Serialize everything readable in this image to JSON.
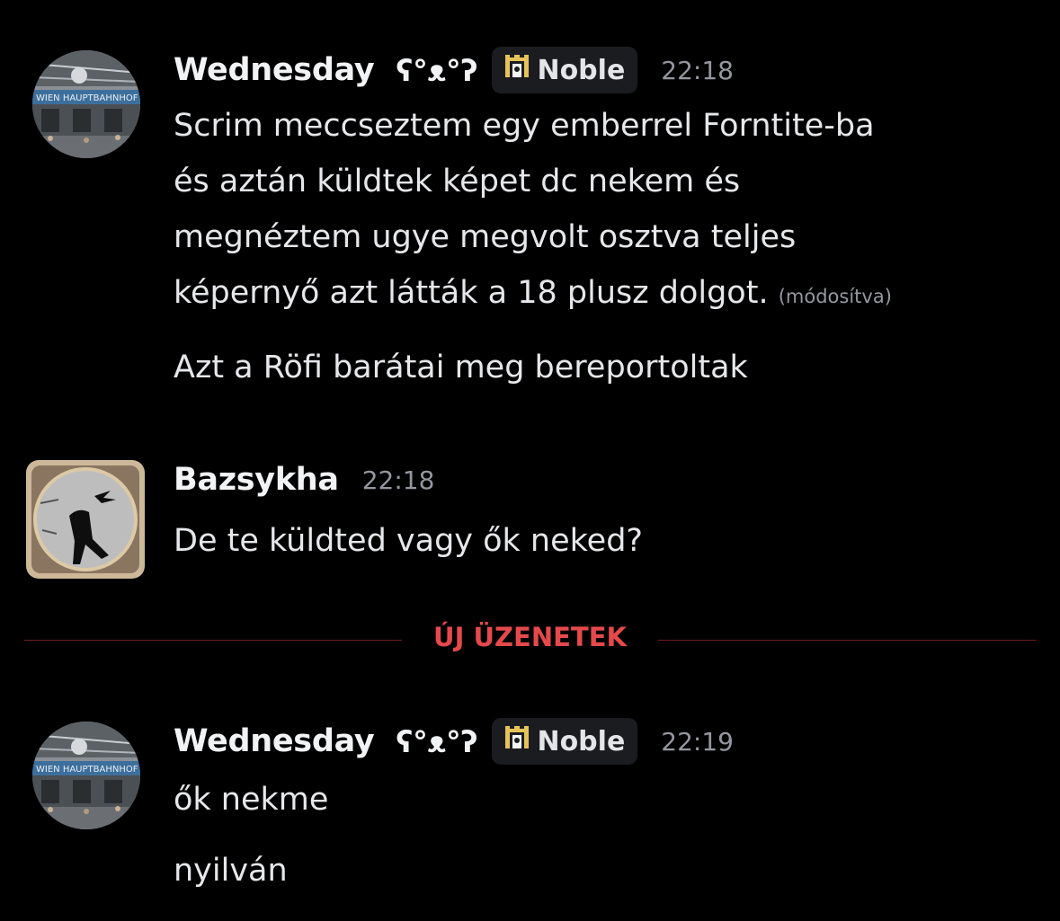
{
  "messages": [
    {
      "author": "Wednesday",
      "author_extra": "ʕ°ᴥ°ʔ",
      "tag": "Noble",
      "time": "22:18",
      "lines": [
        "Scrim meccseztem egy emberrel Forntite-ba\nés aztán küldtek képet dc nekem és\nmegnéztem ugye megvolt osztva teljes\nképernyő azt látták a 18 plusz dolgot.",
        "Azt a Röfi barátai meg bereportoltak"
      ],
      "edited_label": "(módosítva)"
    },
    {
      "author": "Bazsykha",
      "time": "22:18",
      "lines": [
        "De te küldted vagy ők neked?"
      ]
    },
    {
      "author": "Wednesday",
      "author_extra": "ʕ°ᴥ°ʔ",
      "tag": "Noble",
      "time": "22:19",
      "lines": [
        "ők nekme",
        "nyilván"
      ]
    }
  ],
  "divider": {
    "label": "ÚJ ÜZENETEK"
  },
  "avatar_sign_text": "WIEN HAUPTBAHNHOF",
  "colors": {
    "background": "#000000",
    "new_messages": "#e5494c",
    "timestamp": "#9597a0",
    "tag_bg": "#1b1c20"
  }
}
